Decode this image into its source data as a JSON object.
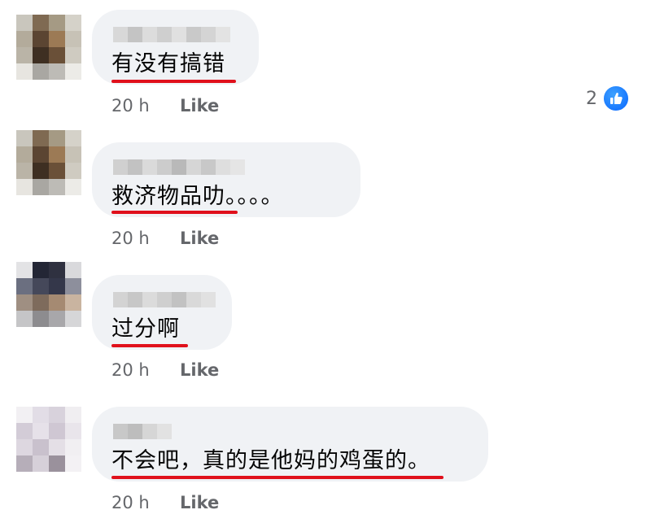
{
  "comments": [
    {
      "text": "有没有搞错",
      "time": "20 h",
      "like_label": "Like",
      "reaction_count": "2"
    },
    {
      "text": "救济物品叻。。。。",
      "time": "20 h",
      "like_label": "Like"
    },
    {
      "text": "过分啊",
      "time": "20 h",
      "like_label": "Like"
    },
    {
      "text": "不会吧，真的是他妈的鸡蛋的。",
      "time": "20 h",
      "like_label": "Like"
    }
  ],
  "colors": {
    "bubble": "#f0f2f5",
    "underline": "#e0101b",
    "meta_text": "#65676b",
    "like_reaction": "#0866ff"
  },
  "icons": [
    "like-reaction-icon"
  ]
}
